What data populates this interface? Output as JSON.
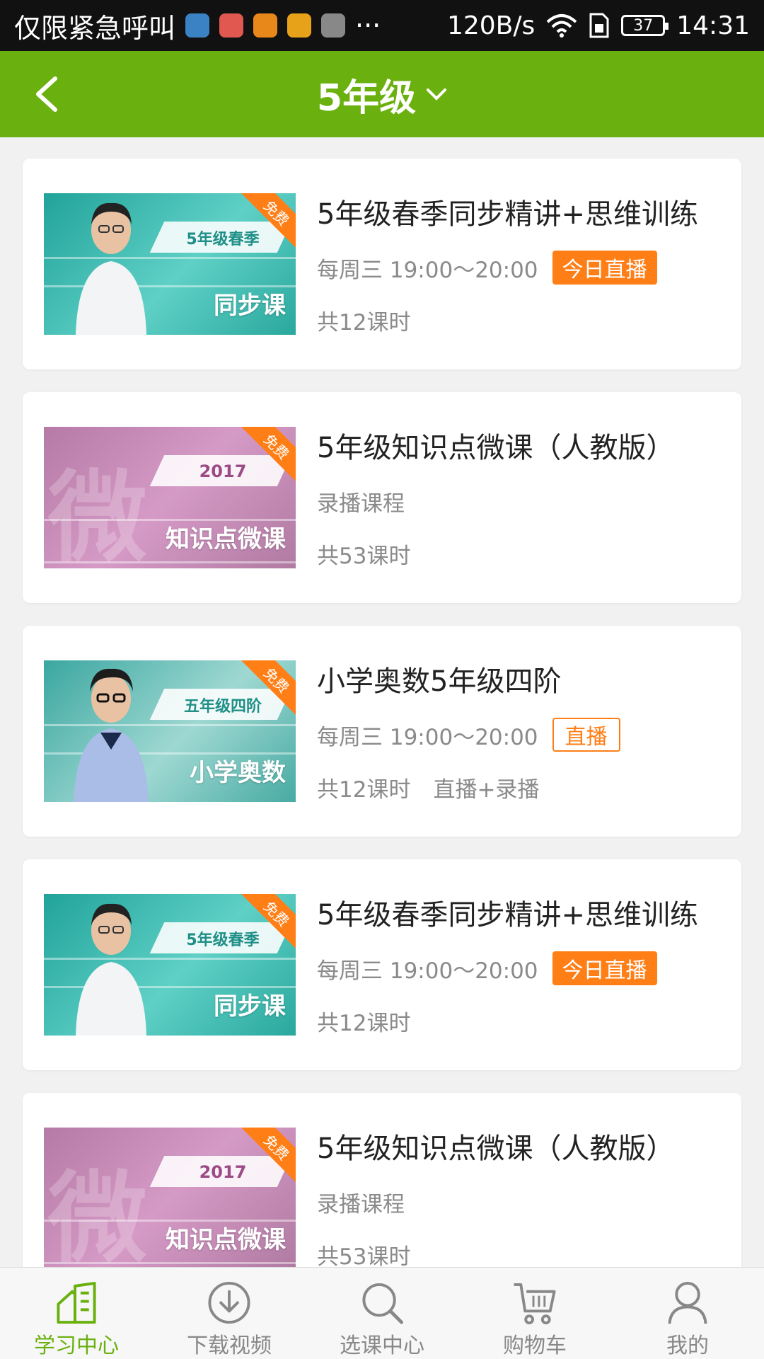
{
  "status_bar": {
    "carrier_text": "仅限紧急呼叫",
    "more": "···",
    "speed": "120B/s",
    "battery": "37",
    "time": "14:31",
    "app_icon_colors": [
      "#3b82c4",
      "#e0584f",
      "#e8881a",
      "#e8a21a",
      "#888888"
    ]
  },
  "header": {
    "title": "5年级",
    "color": "#6ab00e"
  },
  "courses": [
    {
      "thumb_style": "teal",
      "ribbon": "免费",
      "band_text": "5年级春季",
      "main_text": "同步课",
      "title": "5年级春季同步精讲+思维训练",
      "schedule": "每周三 19:00～20:00",
      "tag": "今日直播",
      "lessons": "共12课时"
    },
    {
      "thumb_style": "pink",
      "ribbon": "免费",
      "band_text": "2017",
      "big_char": "微",
      "main_text": "知识点微课",
      "title": "5年级知识点微课（人教版）",
      "type_text": "录播课程",
      "lessons": "共53课时"
    },
    {
      "thumb_style": "teal",
      "ribbon": "免费",
      "band_text": "五年级四阶",
      "main_text": "小学奥数",
      "title": "小学奥数5年级四阶",
      "schedule": "每周三 19:00～20:00",
      "tag": "直播",
      "lessons": "共12课时",
      "mode": "直播+录播"
    },
    {
      "thumb_style": "teal",
      "ribbon": "免费",
      "band_text": "5年级春季",
      "main_text": "同步课",
      "title": "5年级春季同步精讲+思维训练",
      "schedule": "每周三 19:00～20:00",
      "tag": "今日直播",
      "lessons": "共12课时"
    },
    {
      "thumb_style": "pink",
      "ribbon": "免费",
      "band_text": "2017",
      "big_char": "微",
      "main_text": "知识点微课",
      "title": "5年级知识点微课（人教版）",
      "type_text": "录播课程",
      "lessons": "共53课时"
    }
  ],
  "bottom_nav": [
    {
      "label": "学习中心",
      "icon": "home-icon",
      "active": true
    },
    {
      "label": "下载视频",
      "icon": "download-icon",
      "active": false
    },
    {
      "label": "选课中心",
      "icon": "search-icon",
      "active": false
    },
    {
      "label": "购物车",
      "icon": "cart-icon",
      "active": false
    },
    {
      "label": "我的",
      "icon": "user-icon",
      "active": false
    }
  ]
}
